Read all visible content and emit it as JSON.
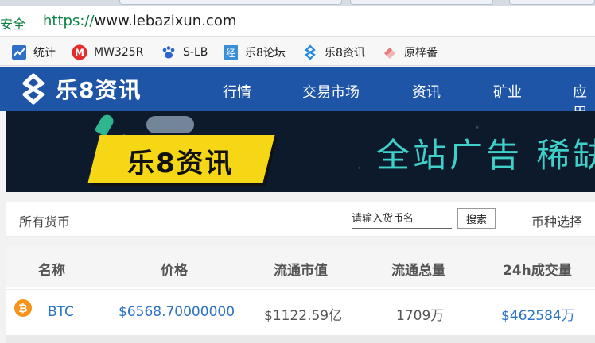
{
  "browser": {
    "security_label": "安全",
    "url_scheme": "https://",
    "url_host": "www.lebazixun.com"
  },
  "bookmarks": [
    {
      "label": "统计",
      "icon": "chart-icon"
    },
    {
      "label": "MW325R",
      "icon": "mercury-router-icon"
    },
    {
      "label": "S-LB",
      "icon": "paw-icon"
    },
    {
      "label": "乐8论坛",
      "icon": "forum-icon"
    },
    {
      "label": "乐8资讯",
      "icon": "le8-logo-icon"
    },
    {
      "label": "原梓番",
      "icon": "eraser-icon"
    }
  ],
  "site": {
    "logo_text": "乐8资讯",
    "nav": [
      "行情",
      "交易市场",
      "资讯",
      "矿业",
      "应用"
    ],
    "header_color": "#1e55a7"
  },
  "banner": {
    "flag_text": "乐8资讯",
    "headline": "全站广告 稀缺"
  },
  "filter": {
    "all_coins": "所有货币",
    "search_placeholder": "请输入货币名",
    "search_button": "搜索",
    "coin_select": "币种选择"
  },
  "table": {
    "headers": [
      "名称",
      "价格",
      "流通市值",
      "流通总量",
      "24h成交量"
    ],
    "rows": [
      {
        "icon": "bitcoin-icon",
        "name": "BTC",
        "price": "$6568.70000000",
        "market_cap": "$1122.59亿",
        "supply": "1709万",
        "volume": "$462584万"
      }
    ]
  }
}
